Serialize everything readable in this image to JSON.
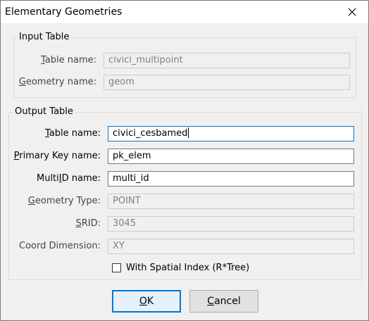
{
  "window": {
    "title": "Elementary Geometries",
    "close_icon": "close-icon"
  },
  "input_table": {
    "legend": "Input Table",
    "table_name_label": "Table name:",
    "table_name_accel": "T",
    "table_name_rest": "able name:",
    "table_name_value": "civici_multipoint",
    "geometry_name_accel": "G",
    "geometry_name_rest": "eometry name:",
    "geometry_name_value": "geom"
  },
  "output_table": {
    "legend": "Output Table",
    "table_name_accel": "T",
    "table_name_rest": "able name:",
    "table_name_value": "civici_cesbamed",
    "primary_key_accel": "P",
    "primary_key_rest": "rimary Key name:",
    "primary_key_value": "pk_elem",
    "multiid_pre": "Multi",
    "multiid_accel": "I",
    "multiid_rest": "D name:",
    "multiid_value": "multi_id",
    "geometry_type_accel": "G",
    "geometry_type_rest": "eometry Type:",
    "geometry_type_value": "POINT",
    "srid_accel": "S",
    "srid_rest": "RID:",
    "srid_value": "3045",
    "coord_dimension_label": "Coord Dimension:",
    "coord_dimension_value": "XY",
    "spatial_index_label": "With Spatial Index (R*Tree)",
    "spatial_index_checked": false
  },
  "buttons": {
    "ok_accel": "O",
    "ok_rest": "K",
    "cancel_accel": "C",
    "cancel_rest": "ancel"
  },
  "colors": {
    "focus_border": "#0078d7",
    "dialog_background": "#f0f0f0"
  }
}
